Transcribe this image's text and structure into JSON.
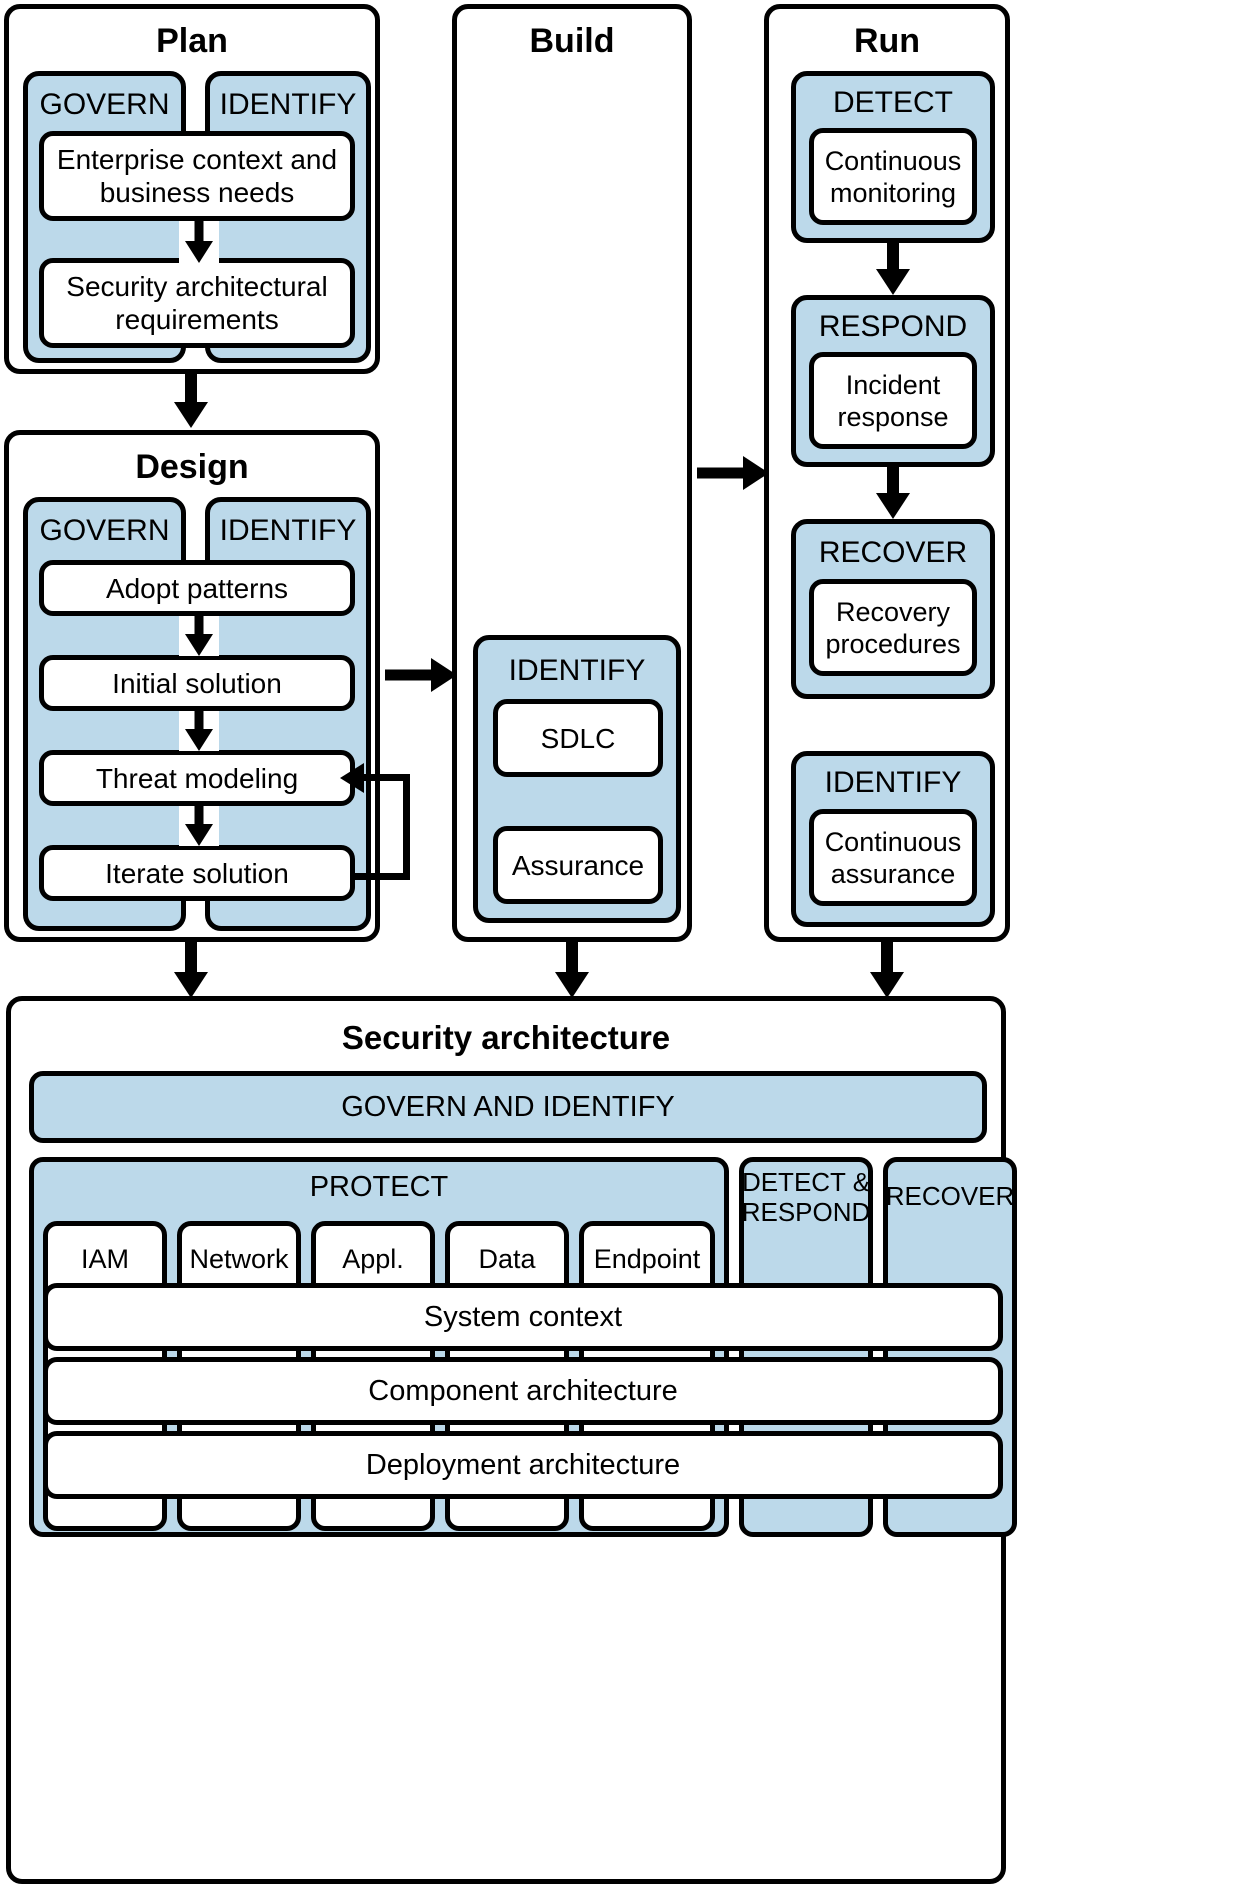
{
  "phases": {
    "plan": {
      "title": "Plan",
      "functions": [
        {
          "label": "GOVERN"
        },
        {
          "label": "IDENTIFY"
        }
      ],
      "steps": [
        {
          "label": "Enterprise context and business needs"
        },
        {
          "label": "Security architectural requirements"
        }
      ]
    },
    "design": {
      "title": "Design",
      "functions": [
        {
          "label": "GOVERN"
        },
        {
          "label": "IDENTIFY"
        }
      ],
      "steps": [
        {
          "label": "Adopt patterns"
        },
        {
          "label": "Initial solution"
        },
        {
          "label": "Threat modeling"
        },
        {
          "label": "Iterate solution"
        }
      ]
    },
    "build": {
      "title": "Build",
      "group": {
        "label": "IDENTIFY",
        "items": [
          {
            "label": "SDLC"
          },
          {
            "label": "Assurance"
          }
        ]
      }
    },
    "run": {
      "title": "Run",
      "groups": [
        {
          "label": "DETECT",
          "items": [
            {
              "label": "Continuous monitoring"
            }
          ]
        },
        {
          "label": "RESPOND",
          "items": [
            {
              "label": "Incident response"
            }
          ]
        },
        {
          "label": "RECOVER",
          "items": [
            {
              "label": "Recovery procedures"
            }
          ]
        },
        {
          "label": "IDENTIFY",
          "items": [
            {
              "label": "Continuous assurance"
            }
          ]
        }
      ]
    }
  },
  "security_architecture": {
    "title": "Security architecture",
    "govern_identify": "GOVERN AND IDENTIFY",
    "columns": [
      {
        "label": "PROTECT"
      },
      {
        "label": "DETECT & RESPOND"
      },
      {
        "label": "RECOVER"
      }
    ],
    "protect_pillars": [
      {
        "label": "IAM"
      },
      {
        "label": "Network"
      },
      {
        "label": "Appl."
      },
      {
        "label": "Data"
      },
      {
        "label": "Endpoint"
      }
    ],
    "layers": [
      {
        "label": "System context"
      },
      {
        "label": "Component architecture"
      },
      {
        "label": "Deployment architecture"
      }
    ]
  },
  "colors": {
    "blue": "#bcd9ea",
    "outline": "#000000",
    "background": "#ffffff"
  }
}
